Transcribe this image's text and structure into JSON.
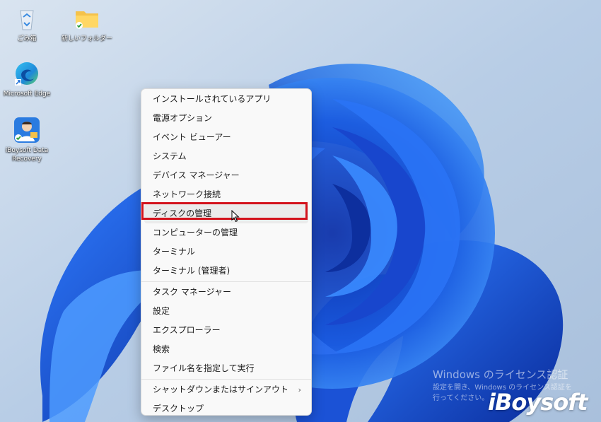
{
  "desktop": {
    "icons": [
      {
        "name": "recycle-bin",
        "label": "ごみ箱"
      },
      {
        "name": "new-folder",
        "label": "新しいフォルダー"
      },
      {
        "name": "microsoft-edge",
        "label": "Microsoft Edge"
      },
      {
        "name": "iboysoft-data-recovery",
        "label": "iBoysoft Data\nRecovery"
      }
    ]
  },
  "context_menu": {
    "groups": [
      [
        {
          "label": "インストールされているアプリ"
        },
        {
          "label": "電源オプション"
        },
        {
          "label": "イベント ビューアー"
        },
        {
          "label": "システム"
        },
        {
          "label": "デバイス マネージャー"
        },
        {
          "label": "ネットワーク接続"
        },
        {
          "label": "ディスクの管理",
          "highlighted": true
        },
        {
          "label": "コンピューターの管理"
        },
        {
          "label": "ターミナル"
        },
        {
          "label": "ターミナル (管理者)"
        }
      ],
      [
        {
          "label": "タスク マネージャー"
        },
        {
          "label": "設定"
        },
        {
          "label": "エクスプローラー"
        },
        {
          "label": "検索"
        },
        {
          "label": "ファイル名を指定して実行"
        }
      ],
      [
        {
          "label": "シャットダウンまたはサインアウト",
          "submenu": true,
          "arrow": "›"
        },
        {
          "label": "デスクトップ"
        }
      ]
    ]
  },
  "activation_watermark": {
    "title": "Windows のライセンス認証",
    "body": "設定を開き、Windows のライセンス認証を\n行ってください。"
  },
  "brand_watermark": "iBoysoft",
  "colors": {
    "highlight_border": "#d3121c",
    "menu_background": "#f9f9f9",
    "wallpaper_blue": "#1f5fd8"
  },
  "icons": {
    "recycle_bin": "recycle-bin-icon",
    "folder": "folder-icon",
    "edge": "edge-icon",
    "iboysoft": "iboysoft-app-icon",
    "submenu": "chevron-right-icon",
    "cursor": "mouse-cursor-icon"
  }
}
